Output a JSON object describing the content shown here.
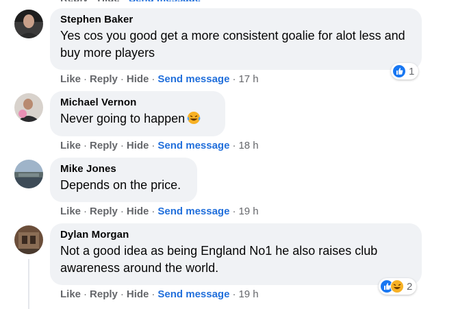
{
  "actions": {
    "like": "Like",
    "reply": "Reply",
    "hide": "Hide",
    "send_message": "Send message",
    "separator": "·"
  },
  "comments": [
    {
      "author": "Stephen Baker",
      "text": "Yes cos you good get a more consistent goalie for alot less and buy more players",
      "time": "17 h",
      "reactions": {
        "icons": [
          "like-icon"
        ],
        "count": "1"
      }
    },
    {
      "author": "Michael Vernon",
      "text": "Never going to happen",
      "emoji": "laughing-tears-emoji",
      "time": "18 h"
    },
    {
      "author": "Mike Jones",
      "text": "Depends on the price.",
      "time": "19 h"
    },
    {
      "author": "Dylan Morgan",
      "text": "Not a good idea as being England No1 he also raises club awareness around the world.",
      "time": "19 h",
      "reactions": {
        "icons": [
          "like-icon",
          "haha-icon"
        ],
        "count": "2"
      }
    }
  ],
  "colors": {
    "bubble": "#f0f2f5",
    "link_blue": "#216fdb",
    "muted": "#65676b",
    "text": "#050505",
    "like_blue": "#1877f2",
    "haha_yellow": "#f7b125"
  }
}
